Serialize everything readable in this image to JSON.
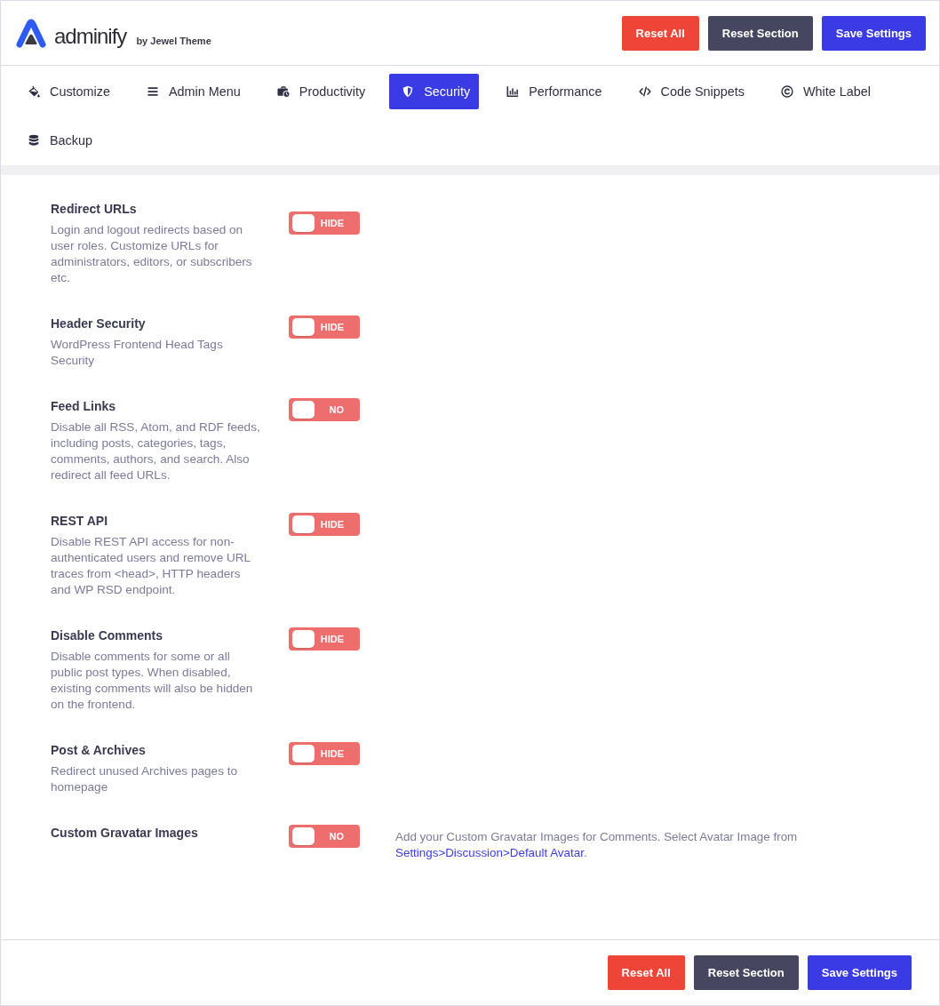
{
  "header": {
    "logo_text": "adminify",
    "byline": "by Jewel Theme",
    "buttons": [
      {
        "label": "Reset All",
        "kind": "danger"
      },
      {
        "label": "Reset Section",
        "kind": "secondary"
      },
      {
        "label": "Save Settings",
        "kind": "primary"
      }
    ]
  },
  "tabs": [
    {
      "label": "Customize",
      "selected": false
    },
    {
      "label": "Admin Menu",
      "selected": false
    },
    {
      "label": "Productivity",
      "selected": false
    },
    {
      "label": "Security",
      "selected": true
    },
    {
      "label": "Performance",
      "selected": false
    },
    {
      "label": "Code Snippets",
      "selected": false
    },
    {
      "label": "White Label",
      "selected": false
    },
    {
      "label": "Backup",
      "selected": false
    }
  ],
  "settings": [
    {
      "title": "Redirect URLs",
      "description": "Login and logout redirects based on user roles. Customize URLs for administrators, editors, or subscribers etc.",
      "toggle": {
        "on": false,
        "label": "HIDE"
      }
    },
    {
      "title": "Header Security",
      "description": "WordPress Frontend Head Tags Security",
      "toggle": {
        "on": false,
        "label": "HIDE"
      }
    },
    {
      "title": "Feed Links",
      "description": "Disable all RSS, Atom, and RDF feeds, including posts, categories, tags, comments, authors, and search. Also redirect all feed URLs.",
      "toggle": {
        "on": false,
        "label": "NO"
      }
    },
    {
      "title": "REST API",
      "description": "Disable REST API access for non-authenticated users and remove URL traces from <head>, HTTP headers and WP RSD endpoint.",
      "toggle": {
        "on": false,
        "label": "HIDE"
      }
    },
    {
      "title": "Disable Comments",
      "description": "Disable comments for some or all public post types. When disabled, existing comments will also be hidden on the frontend.",
      "toggle": {
        "on": false,
        "label": "HIDE"
      }
    },
    {
      "title": "Post & Archives",
      "description": "Redirect unused Archives pages to homepage",
      "toggle": {
        "on": false,
        "label": "HIDE"
      }
    },
    {
      "title": "Custom Gravatar Images",
      "toggle": {
        "on": false,
        "label": "NO"
      },
      "note": {
        "text": "Add your Custom Gravatar Images for Comments. Select Avatar Image from",
        "link": "Settings>Discussion>Default Avatar",
        "after": "."
      }
    }
  ],
  "footer": {
    "buttons": [
      {
        "label": "Reset All",
        "kind": "danger"
      },
      {
        "label": "Reset Section",
        "kind": "secondary"
      },
      {
        "label": "Save Settings",
        "kind": "primary"
      }
    ]
  }
}
